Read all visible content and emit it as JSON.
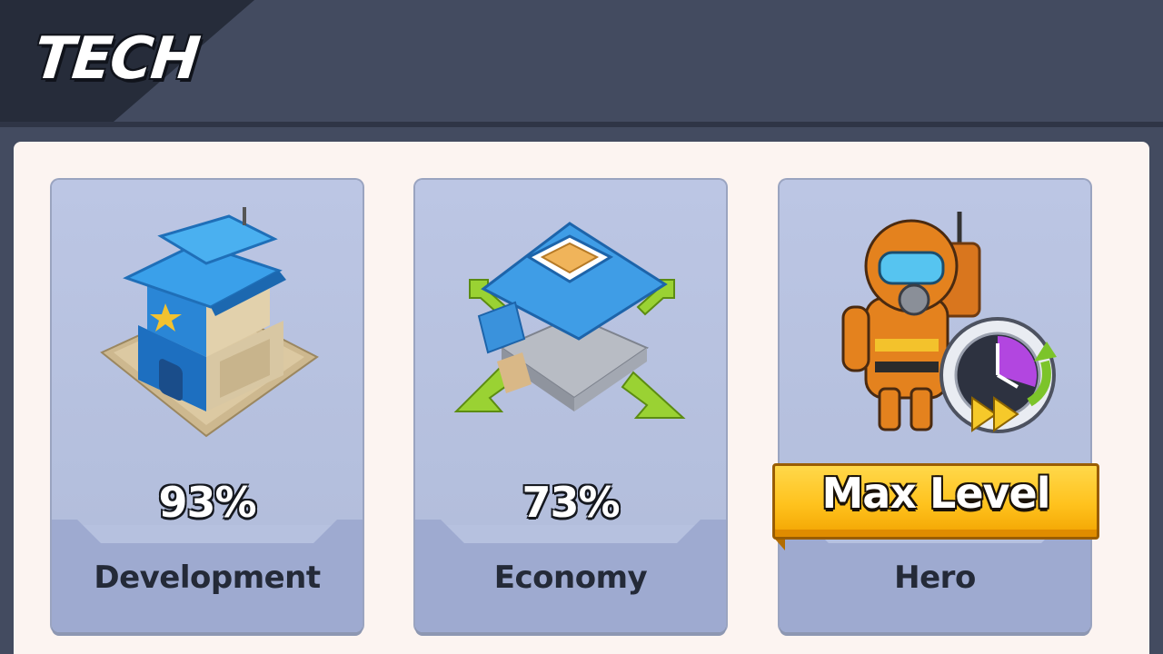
{
  "header": {
    "title": "TECH"
  },
  "cards": [
    {
      "label": "Development",
      "progress_text": "93%",
      "progress": 93,
      "icon": "house-icon"
    },
    {
      "label": "Economy",
      "progress_text": "73%",
      "progress": 73,
      "icon": "storehouse-expand-icon"
    },
    {
      "label": "Hero",
      "status_text": "Max Level",
      "icon": "hero-speedup-icon"
    }
  ],
  "colors": {
    "header_bg": "#434b60",
    "panel_bg": "#fcf4f1",
    "card_bg": "#b6c1df",
    "ribbon_yellow": "#ffc21d"
  }
}
